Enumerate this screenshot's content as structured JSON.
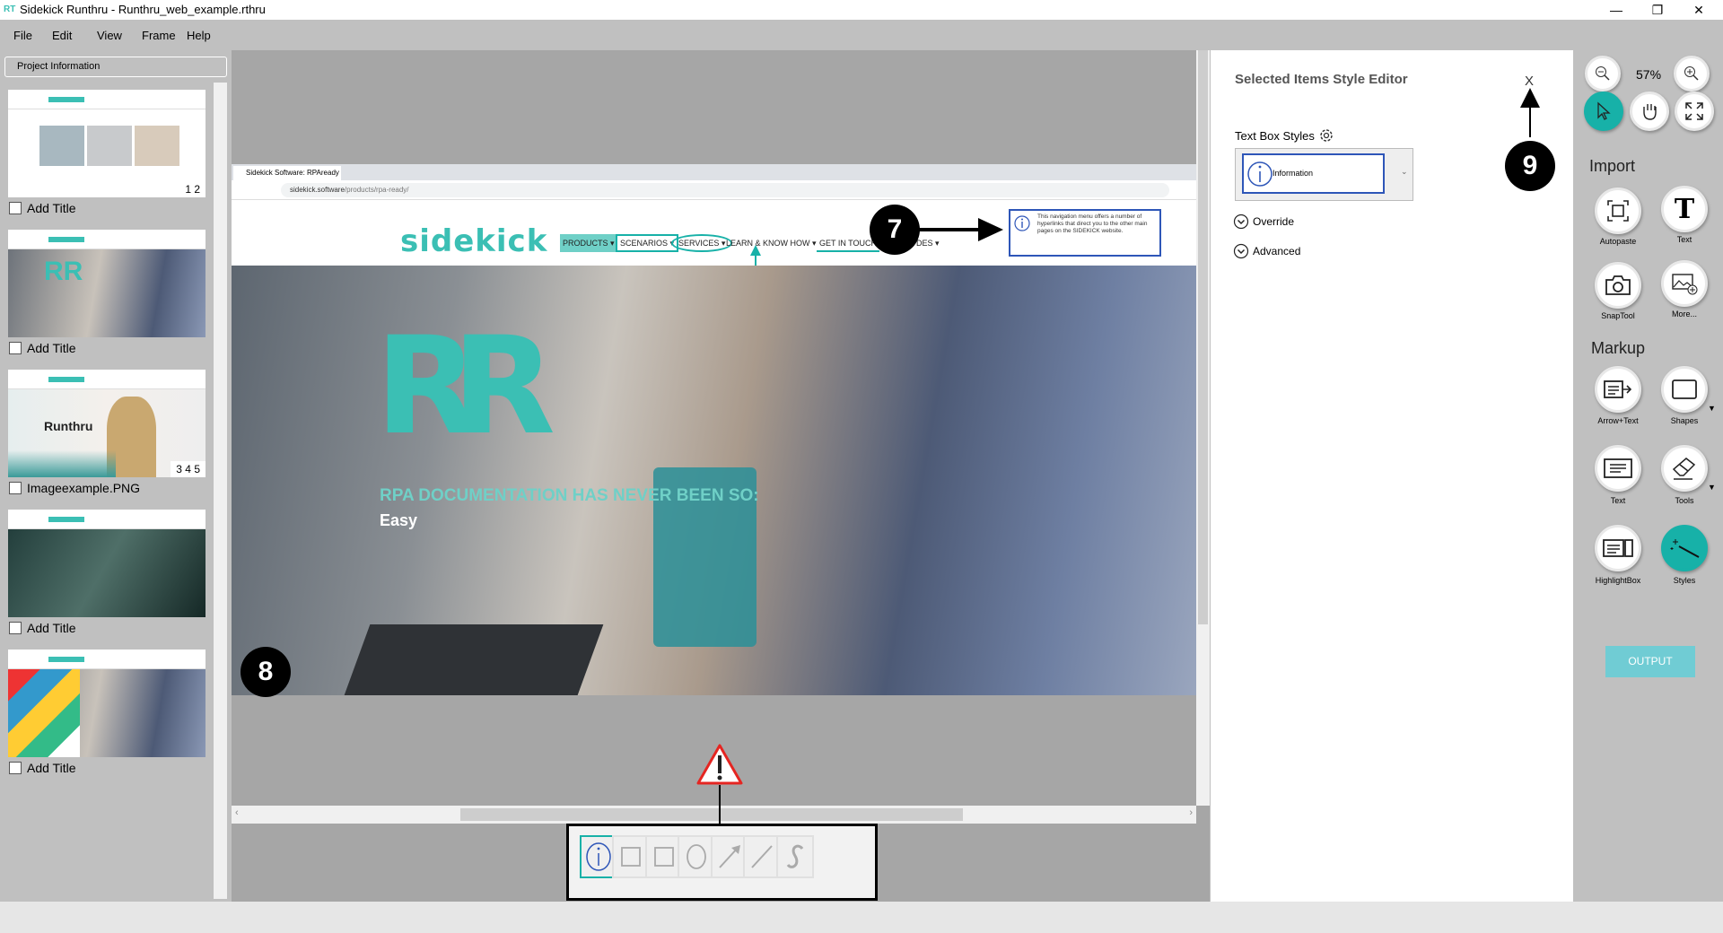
{
  "window": {
    "app_icon": "RT",
    "title": "Sidekick Runthru - Runthru_web_example.rthru",
    "minimize": "—",
    "restore": "❐",
    "close": "✕"
  },
  "menu": [
    "File",
    "Edit",
    "View",
    "Frame",
    "Help"
  ],
  "left_panel": {
    "header": "Project Information",
    "frames": [
      {
        "title": "Add Title",
        "steps": "1 2"
      },
      {
        "title": "Add Title",
        "steps": ""
      },
      {
        "title": "Imageexample.PNG",
        "steps": "3 4 5",
        "brand": "Runthru"
      },
      {
        "title": "Add Title",
        "steps": ""
      },
      {
        "title": "Add Title",
        "steps": ""
      }
    ]
  },
  "screenshot": {
    "tab_title": "Sidekick Software: RPAready",
    "url_host": "sidekick.software",
    "url_path": "/products/rpa-ready/",
    "logo": "sidekick",
    "nav": [
      "PRODUCTS ▾",
      "SCENARIOS ▾",
      "SERVICES ▾",
      "LEARN & KNOW HOW ▾",
      "GET IN TOUCH",
      "DES ▾"
    ],
    "callout": "This navigation menu offers a number of hyperlinks that direct you to the other main pages on the SIDEKICK website.",
    "hero_logo": "RR",
    "hero_headline": "RPA DOCUMENTATION HAS NEVER BEEN SO:",
    "hero_sub": "Easy"
  },
  "badges": {
    "b7": "7",
    "b8": "8",
    "b9": "9"
  },
  "editor": {
    "title": "Selected Items Style Editor",
    "close": "X",
    "text_box_styles": "Text Box Styles",
    "selected_style": "Information",
    "override": "Override",
    "advanced": "Advanced"
  },
  "toolbar": {
    "zoom": "57%",
    "import": "Import",
    "markup": "Markup",
    "import_items": [
      "Autopaste",
      "Text",
      "SnapTool",
      "More..."
    ],
    "markup_items": [
      "Arrow+Text",
      "Shapes",
      "Text",
      "Tools",
      "HighlightBox",
      "Styles"
    ],
    "output": "OUTPUT"
  },
  "colors": {
    "accent": "#17b1a8",
    "selected_blue": "#2e56b8",
    "warning_red": "#e52521"
  }
}
